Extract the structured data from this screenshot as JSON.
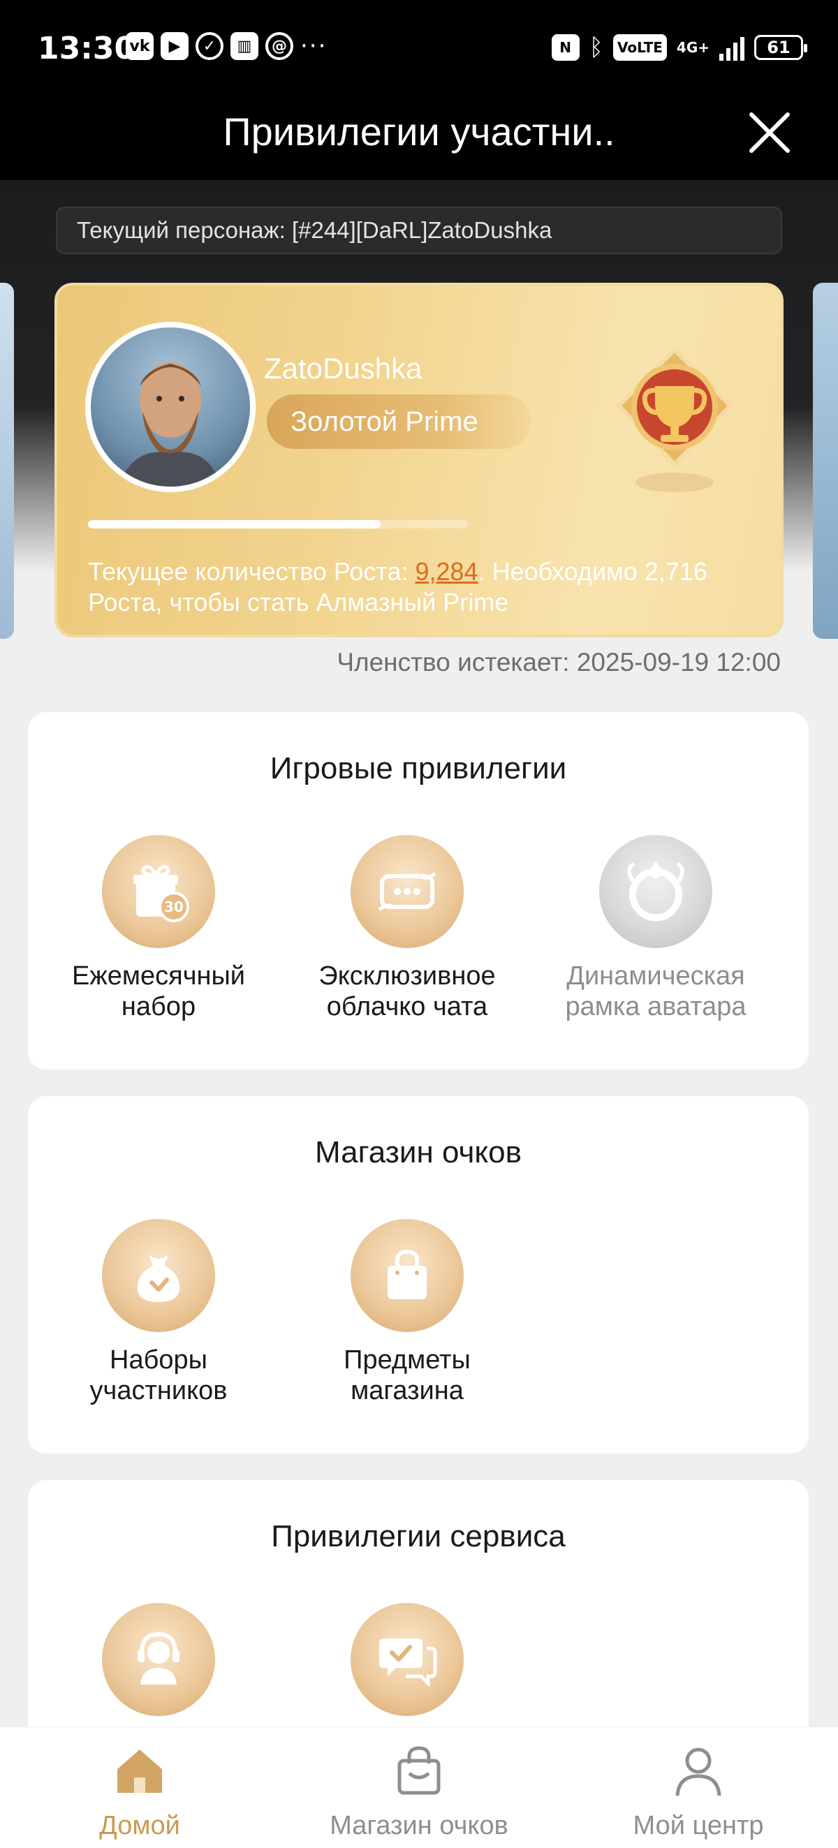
{
  "status_bar": {
    "time": "13:30",
    "app_icons": [
      "vk-icon",
      "youtube-icon",
      "check-circle-icon",
      "stats-icon",
      "at-icon"
    ],
    "more": "···",
    "volte": "VoLTE",
    "network": "4G+",
    "battery": "61"
  },
  "header": {
    "title": "Привилегии участни.."
  },
  "character": {
    "label": "Текущий персонаж: [#244][DaRL]ZatoDushka"
  },
  "prime_card": {
    "username": "ZatoDushka",
    "tier": "Золотой Prime",
    "progress": 0.77,
    "growth_prefix": "Текущее количество Роста: ",
    "growth_value": "9,284",
    "growth_suffix": ". Необходимо 2,716 Роста, чтобы стать Алмазный Prime"
  },
  "expiry": "Членство истекает: 2025-09-19 12:00",
  "sections": {
    "game": {
      "title": "Игровые привилегии",
      "items": [
        {
          "label": "Ежемесячный\nнабор",
          "icon": "gift-30-icon"
        },
        {
          "label": "Эксклюзивное\nоблачко чата",
          "icon": "chat-bubble-icon"
        },
        {
          "label": "Динамическая\nрамка аватара",
          "icon": "avatar-frame-icon"
        }
      ]
    },
    "shop": {
      "title": "Магазин очков",
      "items": [
        {
          "label": "Наборы\nучастников",
          "icon": "bag-heart-icon"
        },
        {
          "label": "Предметы\nмагазина",
          "icon": "shopping-bag-icon"
        }
      ]
    },
    "service": {
      "title": "Привилегии сервиса",
      "items": [
        {
          "icon": "support-agent-icon"
        },
        {
          "icon": "chat-check-icon"
        }
      ]
    }
  },
  "bottom_nav": {
    "home": "Домой",
    "shop": "Магазин очков",
    "profile": "Мой центр"
  },
  "colors": {
    "accent_gold": "#c99a55",
    "growth_highlight": "#e06a1a"
  }
}
